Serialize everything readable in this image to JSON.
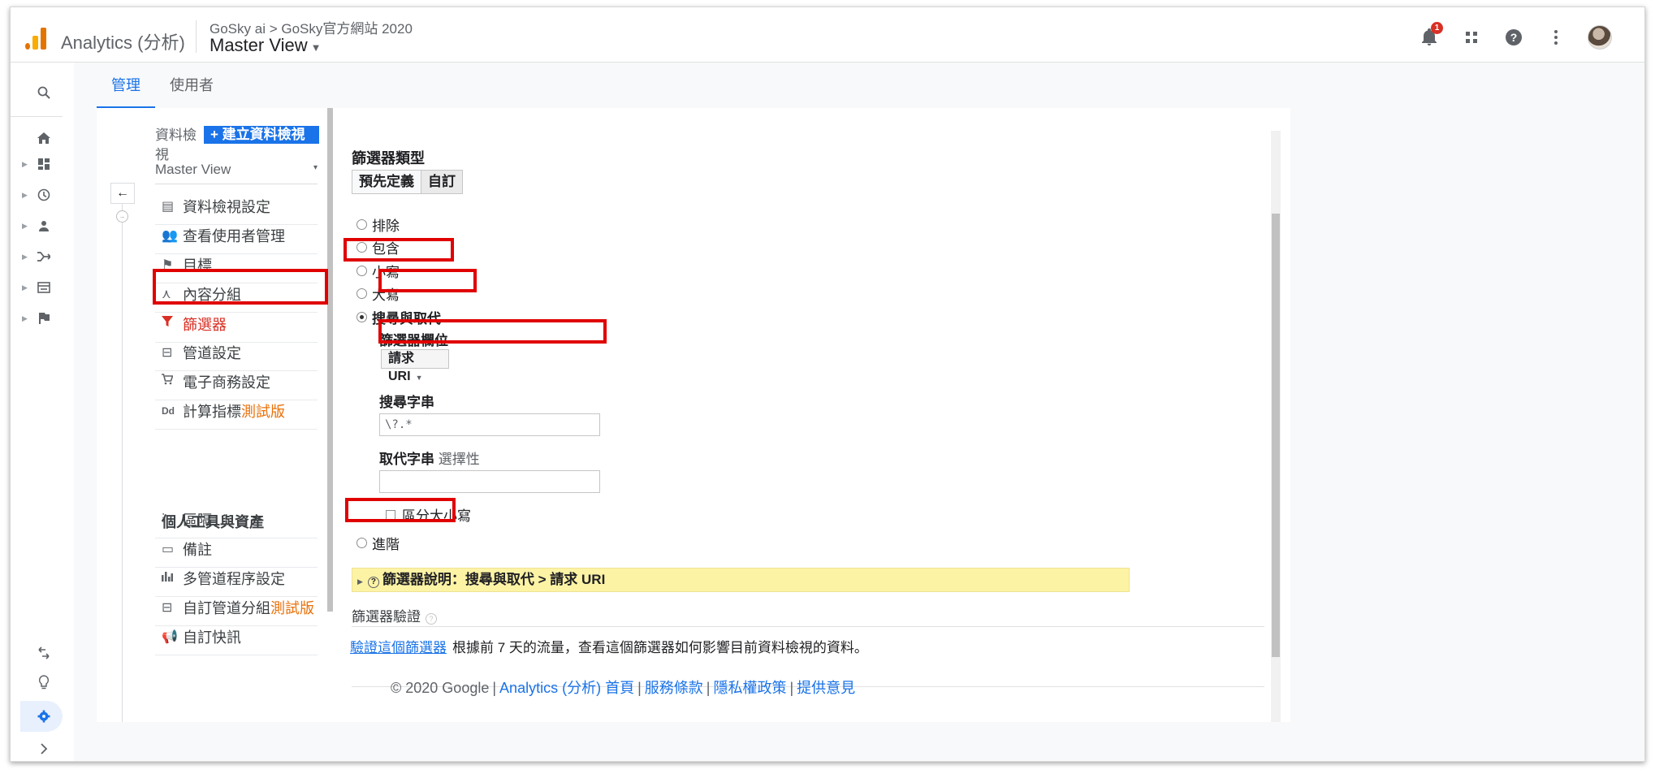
{
  "header": {
    "brand": "Analytics (分析)",
    "breadcrumb": "GoSky ai > GoSky官方網站 2020",
    "view": "Master View",
    "notification_count": "1",
    "icons": [
      "notification-bell-icon",
      "apps-grid-icon",
      "help-icon",
      "more-vert-icon",
      "avatar"
    ]
  },
  "rail": {
    "icons": [
      "search-icon",
      "home-icon",
      "dashboard-icon",
      "clock-icon",
      "person-icon",
      "acquisition-icon",
      "behavior-icon",
      "flag-icon",
      "attribution-icon",
      "discover-icon",
      "settings-icon",
      "expand-icon"
    ]
  },
  "tabs": [
    {
      "label": "管理",
      "active": true
    },
    {
      "label": "使用者",
      "active": false
    }
  ],
  "nav": {
    "view_label": "資料檢視",
    "create_button": "+ 建立資料檢視",
    "view_select": "Master View",
    "items": [
      {
        "label": "資料檢視設定",
        "icon": "document-icon"
      },
      {
        "label": "查看使用者管理",
        "icon": "people-icon"
      },
      {
        "label": "目標",
        "icon": "flag-icon"
      },
      {
        "label": "內容分組",
        "icon": "content-grouping-icon"
      },
      {
        "label": "篩選器",
        "icon": "filter-icon",
        "active": true
      },
      {
        "label": "管道設定",
        "icon": "channel-settings-icon"
      },
      {
        "label": "電子商務設定",
        "icon": "cart-icon"
      },
      {
        "label": "計算指標",
        "badge": "測試版",
        "icon": "dd-icon"
      }
    ],
    "section_title": "個人工具與資產",
    "section_items": [
      {
        "label": "區隔",
        "icon": "segments-icon"
      },
      {
        "label": "備註",
        "icon": "annotation-icon"
      },
      {
        "label": "多管道程序設定",
        "icon": "bar-chart-icon"
      },
      {
        "label": "自訂管道分組",
        "badge": "測試版",
        "icon": "custom-channel-icon"
      },
      {
        "label": "自訂快訊",
        "icon": "megaphone-icon"
      }
    ]
  },
  "form": {
    "filter_type_title": "篩選器類型",
    "seg_predefined": "預先定義",
    "seg_custom": "自訂",
    "options": [
      {
        "label": "排除",
        "checked": false
      },
      {
        "label": "包含",
        "checked": false
      },
      {
        "label": "小寫",
        "checked": false
      },
      {
        "label": "大寫",
        "checked": false
      },
      {
        "label": "搜尋與取代",
        "checked": true
      }
    ],
    "filter_field_label": "篩選器欄位",
    "filter_field_value": "請求 URI",
    "search_string_label": "搜尋字串",
    "search_string_value": "\\?.*",
    "replace_string_label": "取代字串",
    "replace_string_optional": "選擇性",
    "replace_string_value": "",
    "case_sensitive_label": "區分大小寫",
    "advanced_label": "進階",
    "explain_text": "篩選器說明：搜尋與取代 > 請求 URI",
    "verify_title": "篩選器驗證",
    "verify_link": "驗證這個篩選器",
    "verify_desc": "根據前 7 天的流量，查看這個篩選器如何影響目前資料檢視的資料。"
  },
  "footer": {
    "copyright": "© 2020 Google",
    "links": [
      "Analytics (分析) 首頁",
      "服務條款",
      "隱私權政策",
      "提供意見"
    ]
  },
  "colors": {
    "accent": "#1a73e8",
    "highlight": "#e00000",
    "explain_bg": "#fdf3a5",
    "logo_orange": "#f9ab00",
    "logo_dark": "#e37400"
  }
}
